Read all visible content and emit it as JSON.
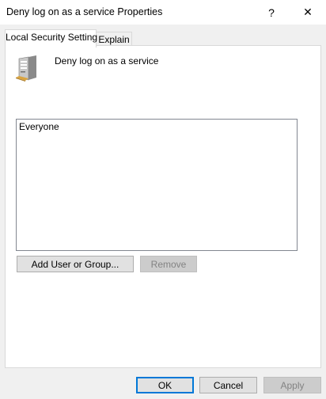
{
  "window": {
    "title": "Deny log on as a service Properties",
    "help_glyph": "?",
    "close_glyph": "✕"
  },
  "tabs": [
    {
      "label": "Local Security Setting",
      "active": true
    },
    {
      "label": "Explain",
      "active": false
    }
  ],
  "policy": {
    "icon": "server-icon",
    "name": "Deny log on as a service"
  },
  "members": [
    "Everyone"
  ],
  "buttons": {
    "add": "Add User or Group...",
    "remove": "Remove",
    "ok": "OK",
    "cancel": "Cancel",
    "apply": "Apply"
  },
  "colors": {
    "accent": "#0078d7",
    "window_bg": "#f0f0f0",
    "panel_bg": "#ffffff"
  }
}
